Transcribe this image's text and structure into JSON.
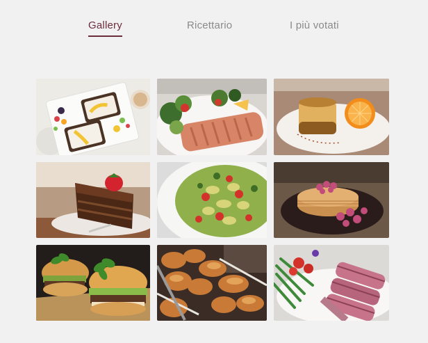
{
  "nav": {
    "tabs": [
      {
        "label": "Gallery",
        "active": true
      },
      {
        "label": "Ricettario",
        "active": false
      },
      {
        "label": "I più votati",
        "active": false
      }
    ],
    "accent_color": "#6b2c3e",
    "inactive_color": "#8a8a8a"
  },
  "gallery": {
    "photos": [
      {
        "subject": "open sandwiches with fruit"
      },
      {
        "subject": "grilled salmon with salad"
      },
      {
        "subject": "baked pudding with orange"
      },
      {
        "subject": "chocolate cake with strawberry"
      },
      {
        "subject": "pasta salad with tomatoes"
      },
      {
        "subject": "pancakes with raspberries"
      },
      {
        "subject": "burgers with basil"
      },
      {
        "subject": "fried chicken"
      },
      {
        "subject": "sliced steak with asparagus"
      }
    ]
  }
}
